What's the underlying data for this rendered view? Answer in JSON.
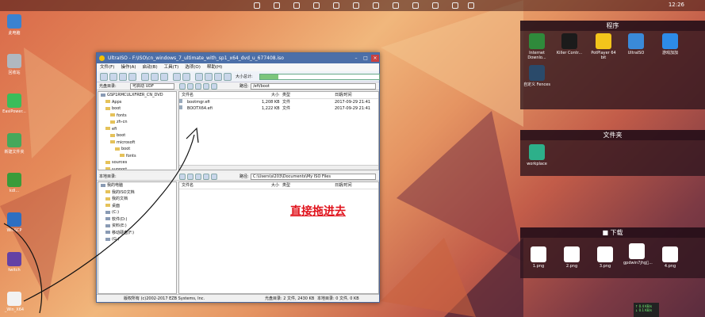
{
  "topbar": {
    "clock": "12:26"
  },
  "desktop_left": [
    {
      "label": "此电脑",
      "name": "this-pc-icon",
      "color": "#3a82d0"
    },
    {
      "label": "回收站",
      "name": "recycle-bin-icon",
      "color": "#b0b8c0"
    },
    {
      "label": "EasiPower...",
      "name": "easipower-icon",
      "color": "#3bbd5a"
    },
    {
      "label": "新建文件夹",
      "name": "folder-app-icon",
      "color": "#45a85b"
    },
    {
      "label": "kdl...",
      "name": "app-icon",
      "color": "#3a9b3a"
    },
    {
      "label": "WinSCP",
      "name": "winscp-icon",
      "color": "#2d6fc2"
    },
    {
      "label": "twitch",
      "name": "twitch-icon",
      "color": "#6441a5"
    },
    {
      "label": "_Win_X64",
      "name": "file-icon",
      "color": "#f2f2f2"
    }
  ],
  "fences": {
    "programs": {
      "title": "程序",
      "items": [
        {
          "label": "Internet Downlo...",
          "name": "idm-icon",
          "color": "#2f8a3b"
        },
        {
          "label": "Killer Contr...",
          "name": "killer-icon",
          "color": "#1b1b1b"
        },
        {
          "label": "PotPlayer 64 bit",
          "name": "potplayer-icon",
          "color": "#f3c51b"
        },
        {
          "label": "UltraISO",
          "name": "ultraiso-icon",
          "color": "#3a8ad8"
        },
        {
          "label": "游戏加加",
          "name": "game-plus-icon",
          "color": "#2d8be8"
        },
        {
          "label": "自定义 Fences",
          "name": "fences-icon",
          "color": "#2a4a6a"
        }
      ]
    },
    "files": {
      "title": "文件夹",
      "items": [
        {
          "label": "workplace",
          "name": "workplace-icon",
          "color": "#2db08a"
        }
      ]
    },
    "downloads": {
      "title": "下载",
      "items": [
        {
          "label": "1.png",
          "name": "image-file-icon"
        },
        {
          "label": "2.png",
          "name": "image-file-icon"
        },
        {
          "label": "3.png",
          "name": "image-file-icon"
        },
        {
          "label": "gpdwin7jhg\u0000...",
          "name": "rar-file-icon"
        },
        {
          "label": "4.png",
          "name": "image-file-icon"
        }
      ]
    }
  },
  "netspeed": {
    "up": "↑ 0.4 KB/s",
    "down": "↓ 0.1 KB/s"
  },
  "window": {
    "title": "UltraISO - F:\\ISO\\cn_windows_7_ultimate_with_sp1_x64_dvd_u_677408.iso",
    "menu": [
      "文件(F)",
      "操作(A)",
      "启动(B)",
      "工具(T)",
      "选项(O)",
      "帮助(H)"
    ],
    "cd_label": "光盘目录:",
    "boot_label": "可启动 UDF",
    "size_text": "728 of 4.7GB - 2500MB free",
    "dvd_label": "大小总计:",
    "iso_path_label": "路径:",
    "iso_path": "/efi/boot",
    "iso_tree": [
      {
        "label": "GSP1RMCULXFRER_CN_DVD",
        "depth": 0,
        "kind": "drv"
      },
      {
        "label": "Apps",
        "depth": 1
      },
      {
        "label": "boot",
        "depth": 1
      },
      {
        "label": "fonts",
        "depth": 2
      },
      {
        "label": "zh-cn",
        "depth": 2
      },
      {
        "label": "efi",
        "depth": 1
      },
      {
        "label": "boot",
        "depth": 2
      },
      {
        "label": "microsoft",
        "depth": 2
      },
      {
        "label": "boot",
        "depth": 3
      },
      {
        "label": "fonts",
        "depth": 4
      },
      {
        "label": "sources",
        "depth": 1
      },
      {
        "label": "support",
        "depth": 1
      },
      {
        "label": "upgrade",
        "depth": 1
      }
    ],
    "iso_headers": {
      "name": "文件名",
      "size": "大小",
      "type": "类型",
      "date": "日期/时间"
    },
    "iso_files": [
      {
        "name": "bootmgr.efi",
        "size": "1,208 KB",
        "type": "文件",
        "date": "2017-09-29 21:41"
      },
      {
        "name": "BOOTX64.efi",
        "size": "1,222 KB",
        "type": "文件",
        "date": "2017-09-29 21:41"
      }
    ],
    "local_label": "本地目录:",
    "local_path_label": "路径:",
    "local_path": "C:\\Users\\sl203\\Documents\\My ISO Files",
    "local_tree": [
      {
        "label": "我的电脑",
        "depth": 0,
        "kind": "drv"
      },
      {
        "label": "我的ISO文档",
        "depth": 1
      },
      {
        "label": "我的文档",
        "depth": 1
      },
      {
        "label": "桌面",
        "depth": 1
      },
      {
        "label": "(C:)",
        "depth": 1,
        "kind": "drv"
      },
      {
        "label": "软件(D:)",
        "depth": 1,
        "kind": "drv"
      },
      {
        "label": "资料(E:)",
        "depth": 1,
        "kind": "drv"
      },
      {
        "label": "移动硬盘(F:)",
        "depth": 1,
        "kind": "drv"
      },
      {
        "label": "(G:)",
        "depth": 1,
        "kind": "drv"
      }
    ],
    "local_headers": {
      "name": "文件名",
      "size": "大小",
      "type": "类型",
      "date": "日期/时间"
    },
    "drag_hint": "直接拖进去",
    "status": {
      "copyright": "版权所有 (c)2002-2017 EZB Systems, Inc.",
      "disc": "光盘目录: 2 文件, 2430 KB",
      "local": "本地目录: 0 文件, 0 KB"
    }
  }
}
